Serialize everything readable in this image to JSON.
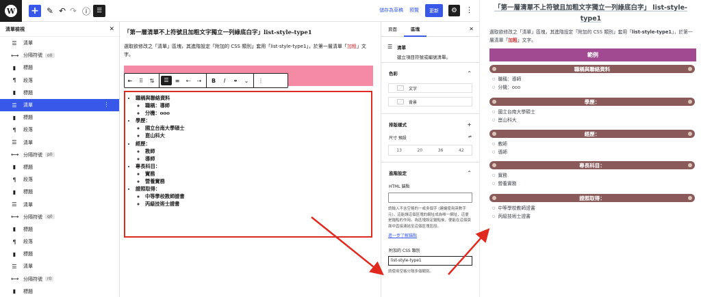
{
  "topbar": {
    "wp_logo": "W",
    "add": "+",
    "save_draft": "儲存為草稿",
    "preview": "預覽",
    "update": "更新"
  },
  "list_view": {
    "title": "清單檢視",
    "items": [
      {
        "icon": "list-icon",
        "glyph": "☰",
        "label": "清單",
        "anchor": ""
      },
      {
        "icon": "separator-icon",
        "glyph": "⟷",
        "label": "分隔符號",
        "anchor": "o0"
      },
      {
        "icon": "heading-icon",
        "glyph": "▮",
        "label": "標題",
        "anchor": ""
      },
      {
        "icon": "paragraph-icon",
        "glyph": "¶",
        "label": "段落",
        "anchor": ""
      },
      {
        "icon": "heading-icon",
        "glyph": "▮",
        "label": "標題",
        "anchor": ""
      },
      {
        "icon": "list-icon",
        "glyph": "☰",
        "label": "清單",
        "anchor": "",
        "selected": true
      },
      {
        "icon": "heading-icon",
        "glyph": "▮",
        "label": "標題",
        "anchor": ""
      },
      {
        "icon": "paragraph-icon",
        "glyph": "¶",
        "label": "段落",
        "anchor": ""
      },
      {
        "icon": "list-icon",
        "glyph": "☰",
        "label": "清單",
        "anchor": ""
      },
      {
        "icon": "separator-icon",
        "glyph": "⟷",
        "label": "分隔符號",
        "anchor": "p0"
      },
      {
        "icon": "heading-icon",
        "glyph": "▮",
        "label": "標題",
        "anchor": ""
      },
      {
        "icon": "paragraph-icon",
        "glyph": "¶",
        "label": "段落",
        "anchor": ""
      },
      {
        "icon": "heading-icon",
        "glyph": "▮",
        "label": "標題",
        "anchor": ""
      },
      {
        "icon": "list-icon",
        "glyph": "☰",
        "label": "清單",
        "anchor": ""
      },
      {
        "icon": "separator-icon",
        "glyph": "⟷",
        "label": "分隔符號",
        "anchor": "q0"
      },
      {
        "icon": "heading-icon",
        "glyph": "▮",
        "label": "標題",
        "anchor": ""
      },
      {
        "icon": "paragraph-icon",
        "glyph": "¶",
        "label": "段落",
        "anchor": ""
      },
      {
        "icon": "heading-icon",
        "glyph": "▮",
        "label": "標題",
        "anchor": ""
      },
      {
        "icon": "list-icon",
        "glyph": "☰",
        "label": "清單",
        "anchor": ""
      },
      {
        "icon": "separator-icon",
        "glyph": "⟷",
        "label": "分隔符號",
        "anchor": "r0"
      },
      {
        "icon": "heading-icon",
        "glyph": "▮",
        "label": "標題",
        "anchor": ""
      }
    ]
  },
  "canvas": {
    "title": "「第一層清單不上符號且加粗文字獨立一列綠底白字」list-style-type1",
    "intro_part1": "選取欲修改之「清單」區塊，其進階設定「附加的 CSS 類別」套用「list-style-type1」，於第一層清單「",
    "intro_red": "加粗",
    "intro_part2": "」文字。",
    "list": [
      {
        "label": "職稱與聯絡資料",
        "children": [
          "職稱：導師",
          "分機：ooo"
        ]
      },
      {
        "label": "學歷：",
        "children": [
          "國立台南大學碩士",
          "崑山科大"
        ]
      },
      {
        "label": "經歷：",
        "children": [
          "教師",
          "導師"
        ]
      },
      {
        "label": "專長科目：",
        "children": [
          "實務",
          "營養實務"
        ]
      },
      {
        "label": "證照取得：",
        "children": [
          "中等學校教師證書",
          "丙級技術士證書"
        ]
      }
    ]
  },
  "sidebar": {
    "tab_page": "頁面",
    "tab_block": "區塊",
    "block_name": "清單",
    "block_desc": "建立項目符號或編號清單。",
    "color_title": "色彩",
    "color_text": "文字",
    "color_bg": "背景",
    "typography_title": "排版樣式",
    "size_label": "尺寸 預設",
    "sizes": [
      "13",
      "20",
      "36",
      "42"
    ],
    "advanced_title": "進階設定",
    "html_anchor_label": "HTML 錨點",
    "html_anchor_help": "請輸入不含空格的一或多個字 (建議使用英數字元)，這能讓這個區塊的網址成為唯一網址，這便是錨點的作用。為區塊設定錨點後，便能在這個頁面中直接連結至這個區塊區段。",
    "help_link": "進一步了解錨點",
    "css_class_label": "附加的 CSS 類別",
    "css_class_value": "list-style-type1",
    "css_class_help": "請使用空格分隔多個類別。"
  },
  "preview": {
    "title": "「第一層清單不上符號且加粗文字獨立一列綠底白字」 list-style-type1",
    "intro_part1": "選取欲修改之「清單」區塊，其進階設定「附加的 CSS 類別」套用「",
    "intro_bold": "list-style-type1",
    "intro_part2": "」，於第一層清單「",
    "intro_red": "加粗",
    "intro_part3": "」文字。",
    "example": "範例",
    "sections": [
      {
        "label": "職稱與聯絡資料",
        "items": [
          "職稱：導師",
          "分機：ooo"
        ]
      },
      {
        "label": "學歷：",
        "items": [
          "國立台南大學碩士",
          "崑山科大"
        ]
      },
      {
        "label": "經歷：",
        "items": [
          "教師",
          "導師"
        ]
      },
      {
        "label": "專長科目：",
        "items": [
          "實務",
          "營養實務"
        ]
      },
      {
        "label": "證照取得：",
        "items": [
          "中等學校教師證書",
          "丙級技術士證書"
        ]
      }
    ]
  },
  "colors": {
    "accent": "#3858e9",
    "annotation_red": "#e02a1f",
    "example_bar": "#a14a92",
    "section_head": "#8a5a5a"
  }
}
